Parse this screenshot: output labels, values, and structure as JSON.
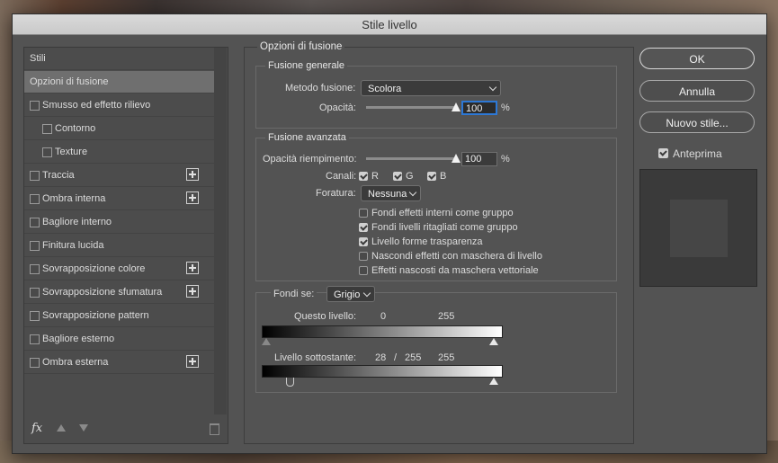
{
  "window": {
    "title": "Stile livello"
  },
  "style_list": {
    "header": "Stili",
    "items": [
      {
        "label": "Opzioni di fusione",
        "selected": true,
        "checkbox": false,
        "plus": false,
        "indent": 0
      },
      {
        "label": "Smusso ed effetto rilievo",
        "checkbox": true,
        "plus": false,
        "indent": 0
      },
      {
        "label": "Contorno",
        "checkbox": true,
        "plus": false,
        "indent": 1
      },
      {
        "label": "Texture",
        "checkbox": true,
        "plus": false,
        "indent": 1
      },
      {
        "label": "Traccia",
        "checkbox": true,
        "plus": true,
        "indent": 0
      },
      {
        "label": "Ombra interna",
        "checkbox": true,
        "plus": true,
        "indent": 0
      },
      {
        "label": "Bagliore interno",
        "checkbox": true,
        "plus": false,
        "indent": 0
      },
      {
        "label": "Finitura lucida",
        "checkbox": true,
        "plus": false,
        "indent": 0
      },
      {
        "label": "Sovrapposizione colore",
        "checkbox": true,
        "plus": true,
        "indent": 0
      },
      {
        "label": "Sovrapposizione sfumatura",
        "checkbox": true,
        "plus": true,
        "indent": 0
      },
      {
        "label": "Sovrapposizione pattern",
        "checkbox": true,
        "plus": false,
        "indent": 0
      },
      {
        "label": "Bagliore esterno",
        "checkbox": true,
        "plus": false,
        "indent": 0
      },
      {
        "label": "Ombra esterna",
        "checkbox": true,
        "plus": true,
        "indent": 0
      }
    ],
    "fx_label": "fx"
  },
  "blend": {
    "title": "Opzioni di fusione",
    "general": {
      "title": "Fusione generale",
      "mode_label": "Metodo fusione:",
      "mode_value": "Scolora",
      "opacity_label": "Opacità:",
      "opacity_value": "100",
      "opacity_unit": "%",
      "opacity_level": 1.0
    },
    "advanced": {
      "title": "Fusione avanzata",
      "fill_label": "Opacità riempimento:",
      "fill_value": "100",
      "fill_unit": "%",
      "fill_level": 1.0,
      "channels_label": "Canali:",
      "channel_r": "R",
      "channel_g": "G",
      "channel_b": "B",
      "knockout_label": "Foratura:",
      "knockout_value": "Nessuna",
      "options": [
        {
          "label": "Fondi effetti interni come gruppo",
          "checked": false
        },
        {
          "label": "Fondi livelli ritagliati come gruppo",
          "checked": true
        },
        {
          "label": "Livello forme trasparenza",
          "checked": true
        },
        {
          "label": "Nascondi effetti con maschera di livello",
          "checked": false
        },
        {
          "label": "Effetti nascosti da maschera vettoriale",
          "checked": false
        }
      ]
    },
    "blendif": {
      "label": "Fondi se:",
      "value": "Grigio",
      "this_layer_label": "Questo livello:",
      "this_layer_low": "0",
      "this_layer_high": "255",
      "underlying_label": "Livello sottostante:",
      "underlying_low": "28",
      "underlying_sep": "/",
      "underlying_mid": "255",
      "underlying_high": "255"
    }
  },
  "buttons": {
    "ok": "OK",
    "cancel": "Annulla",
    "new_style": "Nuovo stile...",
    "preview_label": "Anteprima",
    "preview_checked": true
  }
}
